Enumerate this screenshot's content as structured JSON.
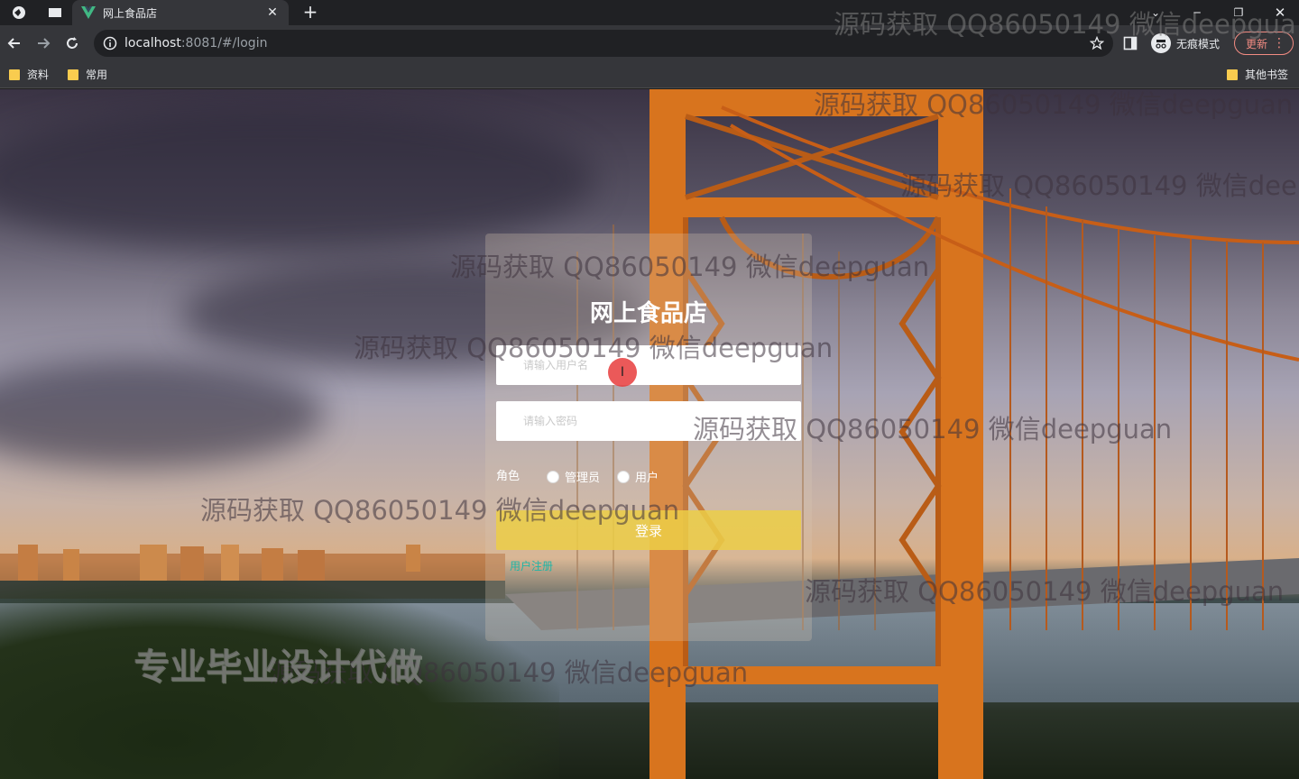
{
  "browser": {
    "tab_title": "网上食品店",
    "url_host": "localhost",
    "url_rest": ":8081/#/login",
    "incognito_label": "无痕模式",
    "update_label": "更新",
    "bookmarks": [
      "资料",
      "常用"
    ],
    "other_bookmarks": "其他书签"
  },
  "login": {
    "title": "网上食品店",
    "username_placeholder": "请输入用户名",
    "password_placeholder": "请输入密码",
    "role_label": "角色",
    "role_options": [
      "管理员",
      "用户"
    ],
    "login_button": "登录",
    "register_link": "用户注册"
  },
  "overlay": {
    "watermark": "源码获取 QQ86050149 微信deepguan",
    "watermark_clipped_top": "源码获取 QQ86050149 微信deepgua",
    "watermark_clipped_right": "源码获取 QQ86050149 微信dee",
    "watermark_card": "源码获取 QQ86050149 微信deepguan",
    "promo_text": "专业毕业设计代做",
    "cursor_glyph": "I"
  },
  "colors": {
    "accent_button": "#ecce46",
    "register_link": "#1fb5a6",
    "update_button": "#f28b82"
  }
}
